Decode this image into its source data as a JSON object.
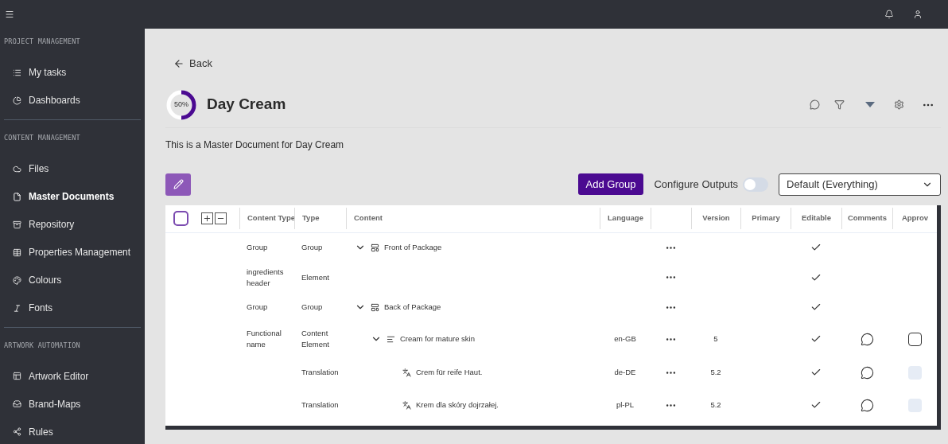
{
  "sidebar": {
    "sections": [
      {
        "title": "PROJECT MANAGEMENT",
        "items": [
          {
            "label": "My tasks",
            "selected": false
          },
          {
            "label": "Dashboards",
            "selected": false
          }
        ]
      },
      {
        "title": "CONTENT MANAGEMENT",
        "items": [
          {
            "label": "Files",
            "selected": false
          },
          {
            "label": "Master Documents",
            "selected": true
          },
          {
            "label": "Repository",
            "selected": false
          },
          {
            "label": "Properties Management",
            "selected": false
          },
          {
            "label": "Colours",
            "selected": false
          },
          {
            "label": "Fonts",
            "selected": false
          }
        ]
      },
      {
        "title": "ARTWORK AUTOMATION",
        "items": [
          {
            "label": "Artwork Editor",
            "selected": false
          },
          {
            "label": "Brand-Maps",
            "selected": false
          },
          {
            "label": "Rules",
            "selected": false
          }
        ]
      }
    ]
  },
  "back": "Back",
  "document": {
    "progress": {
      "level": 0.5,
      "label": "50%"
    },
    "title": "Day Cream",
    "description": "This is a Master Document for Day Cream"
  },
  "toolbar": {
    "add_group": "Add Group",
    "configure_outputs": {
      "label": "Configure Outputs",
      "on": false
    },
    "output_select": "Default (Everything)"
  },
  "table": {
    "select_all": {
      "checked": false
    },
    "columns": [
      "Content Type",
      "Type",
      "Content",
      "Language",
      "",
      "Version",
      "Primary",
      "Editable",
      "Comments",
      "Approv"
    ],
    "rows": [
      {
        "content_type": "Group",
        "type": "Group",
        "content": "Front of Package",
        "kind": "group",
        "expanded": true,
        "editable": true,
        "comments": false,
        "children": [
          {
            "content_type": "ingredients header",
            "type": "Element",
            "editable": true,
            "comments": false
          }
        ]
      },
      {
        "content_type": "Group",
        "type": "Group",
        "content": "Back of Package",
        "kind": "group",
        "expanded": true,
        "editable": true,
        "comments": false,
        "children": [
          {
            "content_type": "Functional name",
            "type": "Content Element",
            "content": "Cream for mature skin",
            "kind": "element",
            "expanded": true,
            "language": "en-GB",
            "version": "5",
            "editable": true,
            "comments": true,
            "approval": {
              "checked": false,
              "disabled": false
            },
            "children": [
              {
                "type": "Translation",
                "content": "Crem für reife Haut.",
                "kind": "translation",
                "language": "de-DE",
                "version": "5.2",
                "editable": true,
                "comments": true,
                "approval": {
                  "checked": false,
                  "disabled": true
                }
              },
              {
                "type": "Translation",
                "content": "Krem dla skóry dojrzałej.",
                "kind": "translation",
                "language": "pl-PL",
                "version": "5.2",
                "editable": true,
                "comments": true,
                "approval": {
                  "checked": false,
                  "disabled": true
                }
              }
            ]
          }
        ]
      }
    ]
  }
}
